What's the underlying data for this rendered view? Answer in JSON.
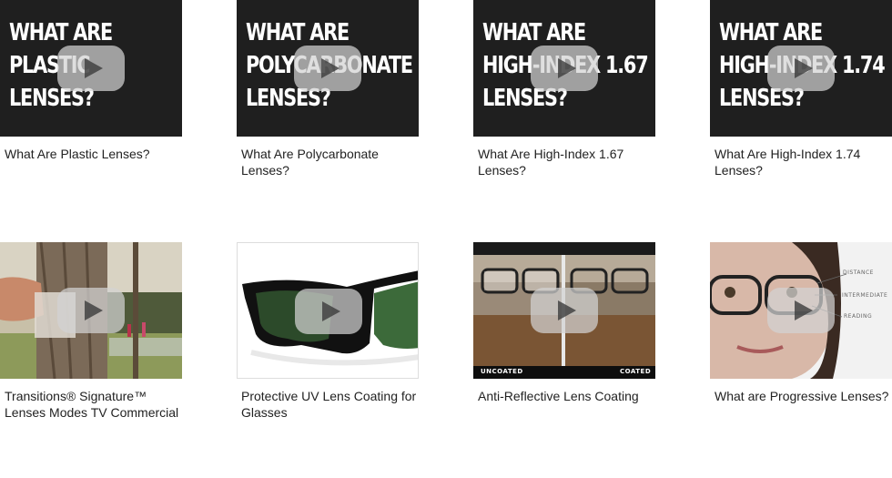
{
  "videos": [
    {
      "thumb_title": [
        "WHAT ARE",
        "PLASTIC",
        "LENSES?"
      ],
      "caption": "What Are Plastic Lenses?"
    },
    {
      "thumb_title": [
        "WHAT ARE",
        "POLYCARBONATE",
        "LENSES?"
      ],
      "caption": "What Are Polycarbonate Lenses?"
    },
    {
      "thumb_title": [
        "WHAT ARE",
        "HIGH-INDEX 1.67",
        "LENSES?"
      ],
      "caption": "What Are High-Index 1.67 Lenses?"
    },
    {
      "thumb_title": [
        "WHAT ARE",
        "HIGH-INDEX 1.74",
        "LENSES?"
      ],
      "caption": "What Are High-Index 1.74 Lenses?"
    },
    {
      "caption": "Transitions® Signature™ Lenses Modes TV Commercial"
    },
    {
      "caption": "Protective UV Lens Coating for Glasses"
    },
    {
      "caption": "Anti-Reflective Lens Coating",
      "overlay": {
        "left": "UNCOATED",
        "right": "COATED"
      }
    },
    {
      "caption": "What are Progressive Lenses?",
      "overlay": {
        "distance": "DISTANCE",
        "intermediate": "INTERMEDIATE",
        "reading": "READING"
      }
    }
  ]
}
